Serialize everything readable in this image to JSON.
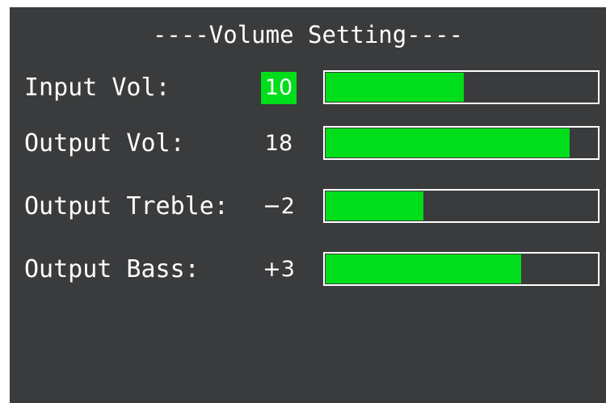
{
  "title": "----Volume Setting----",
  "colors": {
    "background": "#3a3b3c",
    "accent": "#00dd1a",
    "text": "#ffffff"
  },
  "rows": [
    {
      "label": "Input Vol:",
      "value": "10",
      "level": 0.51,
      "selected": true
    },
    {
      "label": "Output Vol:",
      "value": "18",
      "level": 0.9,
      "selected": false
    },
    {
      "label": "Output Treble:",
      "value": "−2",
      "level": 0.36,
      "selected": false
    },
    {
      "label": "Output Bass:",
      "value": "+3",
      "level": 0.72,
      "selected": false
    }
  ]
}
